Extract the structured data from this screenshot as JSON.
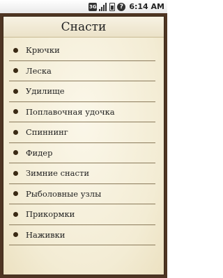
{
  "status_bar": {
    "network_label": "3G",
    "time": "6:14 AM",
    "icons": [
      "3g-icon",
      "signal-icon",
      "battery-icon",
      "alert-icon"
    ]
  },
  "header": {
    "title": "Снасти"
  },
  "list": {
    "items": [
      {
        "label": "Крючки"
      },
      {
        "label": "Леска"
      },
      {
        "label": "Удилище"
      },
      {
        "label": "Поплавочная удочка"
      },
      {
        "label": "Спиннинг"
      },
      {
        "label": "Фидер"
      },
      {
        "label": "Зимние снасти"
      },
      {
        "label": "Рыболовные узлы"
      },
      {
        "label": "Прикормки"
      },
      {
        "label": "Наживки"
      }
    ]
  },
  "colors": {
    "frame": "#4e3523",
    "panel": "#f6f0dc",
    "divider": "#8a7a5b",
    "bullet": "#3a2a14"
  }
}
